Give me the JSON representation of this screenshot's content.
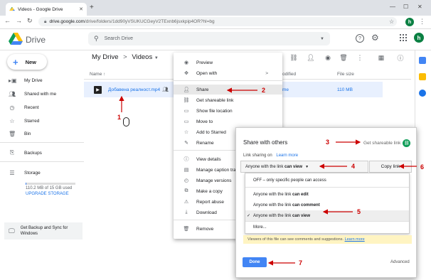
{
  "browser": {
    "tab_title": "Videos - Google Drive",
    "new_tab": "+",
    "url_host": "drive.google.com",
    "url_path": "/drive/folders/1dd90yVSUKUCGeyV2TExnb6jsxkpip4OR?hl=bg",
    "profile_letter": "h"
  },
  "drive": {
    "logo_text": "Drive",
    "search_placeholder": "Search Drive",
    "new_label": "New",
    "sidebar": [
      {
        "label": "My Drive",
        "icon": "my-drive-icon"
      },
      {
        "label": "Shared with me",
        "icon": "shared-icon"
      },
      {
        "label": "Recent",
        "icon": "clock-icon"
      },
      {
        "label": "Starred",
        "icon": "star-icon"
      },
      {
        "label": "Bin",
        "icon": "trash-icon"
      }
    ],
    "backups_label": "Backups",
    "storage_label": "Storage",
    "storage_used": "110.2 MB of 15 GB used",
    "storage_fraction": 0.007,
    "upgrade_label": "UPGRADE STORAGE",
    "backup_promo": "Get Backup and Sync for Windows",
    "breadcrumb_root": "My Drive",
    "breadcrumb_sep": ">",
    "breadcrumb_current": "Videos",
    "columns": {
      "name": "Name",
      "modified": "odified",
      "size": "File size"
    },
    "file": {
      "name": "Добавена реалност.mp4",
      "modified": "me",
      "size": "110 MB"
    }
  },
  "context_menu": {
    "items": [
      {
        "label": "Preview",
        "icon": "eye-icon"
      },
      {
        "label": "Open with",
        "icon": "open-with-icon",
        "submenu": ">"
      },
      {
        "label": "Share",
        "icon": "person-add-icon"
      },
      {
        "label": "Get shareable link",
        "icon": "link-icon"
      },
      {
        "label": "Show file location",
        "icon": "folder-icon"
      },
      {
        "label": "Move to",
        "icon": "move-icon"
      },
      {
        "label": "Add to Starred",
        "icon": "star-icon"
      },
      {
        "label": "Rename",
        "icon": "pencil-icon"
      },
      {
        "label": "View details",
        "icon": "info-icon"
      },
      {
        "label": "Manage caption tra",
        "icon": "caption-icon"
      },
      {
        "label": "Manage versions",
        "icon": "history-icon"
      },
      {
        "label": "Make a copy",
        "icon": "copy-icon"
      },
      {
        "label": "Report abuse",
        "icon": "alert-icon"
      },
      {
        "label": "Download",
        "icon": "download-icon"
      },
      {
        "label": "Remove",
        "icon": "trash-icon"
      }
    ]
  },
  "share_dialog": {
    "title": "Share with others",
    "get_link": "Get shareable link",
    "link_sharing_on": "Link sharing on",
    "learn_more": "Learn more",
    "dropdown_prefix": "Anyone with the link",
    "dropdown_bold": "can view",
    "copy_link": "Copy link",
    "options": [
      {
        "text": "OFF – only specific people can access",
        "bold": ""
      },
      {
        "text": "Anyone with the link",
        "bold": "can edit"
      },
      {
        "text": "Anyone with the link",
        "bold": "can comment"
      },
      {
        "text": "Anyone with the link",
        "bold": "can view",
        "selected": true
      },
      {
        "text": "More...",
        "bold": ""
      }
    ],
    "warning": "Viewers of this file can see comments and suggestions.",
    "warning_link": "Learn more",
    "done": "Done",
    "advanced": "Advanced"
  },
  "annotations": [
    "1",
    "2",
    "3",
    "4",
    "5",
    "6",
    "7"
  ],
  "colors": {
    "accent": "#4285f4",
    "annotation": "#cc0000",
    "selected_row": "#e8f0fe"
  }
}
